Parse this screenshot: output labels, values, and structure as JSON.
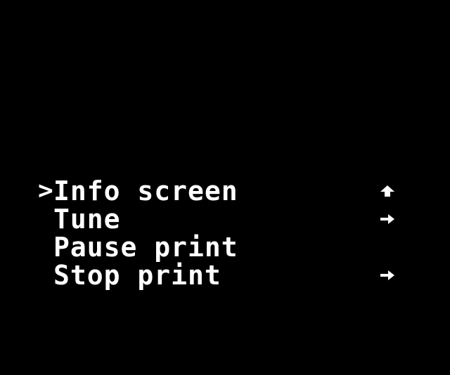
{
  "menu": {
    "cursor": ">",
    "items": [
      {
        "label": "Info screen",
        "icon": "up-arrow-icon"
      },
      {
        "label": "Tune",
        "icon": "right-arrow-icon"
      },
      {
        "label": "Pause print",
        "icon": ""
      },
      {
        "label": "Stop print",
        "icon": "right-arrow-icon"
      }
    ]
  },
  "colors": {
    "background": "#000000",
    "foreground": "#ffffff"
  }
}
